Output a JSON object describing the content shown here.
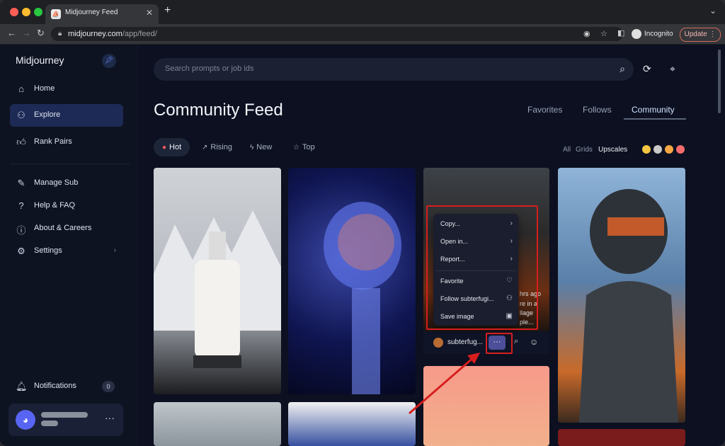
{
  "browser": {
    "tab_title": "Midjourney Feed",
    "tab_favicon": "⛵",
    "url_domain": "midjourney.com",
    "url_path": "/app/feed/",
    "profile_label": "Incognito",
    "update_label": "Update"
  },
  "sidebar": {
    "brand": "Midjourney",
    "items": [
      {
        "label": "Home",
        "icon": "home-icon"
      },
      {
        "label": "Explore",
        "icon": "explore-icon"
      },
      {
        "label": "Rank Pairs",
        "icon": "thumbs-up-icon"
      },
      {
        "label": "Manage Sub",
        "icon": "edit-icon"
      },
      {
        "label": "Help & FAQ",
        "icon": "help-icon"
      },
      {
        "label": "About & Careers",
        "icon": "info-icon"
      },
      {
        "label": "Settings",
        "icon": "gear-icon"
      }
    ],
    "notifications_label": "Notifications",
    "notifications_count": "0"
  },
  "search": {
    "placeholder": "Search prompts or job ids"
  },
  "page_title": "Community Feed",
  "feed_tabs": [
    "Favorites",
    "Follows",
    "Community"
  ],
  "sort_tabs": [
    "Hot",
    "Rising",
    "New",
    "Top"
  ],
  "filters": [
    "All",
    "Grids",
    "Upscales"
  ],
  "card_strip": {
    "username": "subterfug...",
    "more": "···"
  },
  "bg_overlay": [
    "hrs ago",
    "re in a",
    "llage",
    "ple..."
  ],
  "context_menu": {
    "items": [
      "Copy...",
      "Open in...",
      "Report...",
      "Favorite",
      "Follow subterfugi...",
      "Save image"
    ]
  },
  "colors": {
    "accent": "#1d2a55",
    "highlight": "#d71e1e",
    "background": "#0c1020"
  }
}
